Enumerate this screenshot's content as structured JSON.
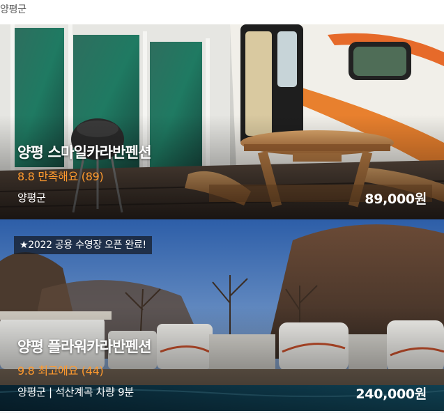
{
  "header": {
    "region": "양평군"
  },
  "listings": [
    {
      "name": "양평 스마일카라반펜션",
      "rating": "8.8 만족해요 (89)",
      "location": "양평군",
      "price": "89,000원"
    },
    {
      "promo": "★2022 공용 수영장 오픈 완료!",
      "name": "양평 플라워카라반펜션",
      "rating": "9.8 최고에요 (44)",
      "location": "양평군 | 석산계곡 차량 9분",
      "price": "240,000원"
    }
  ],
  "colors": {
    "rating": "#ff9a2e",
    "text": "#ffffff",
    "header_text": "#555555"
  }
}
